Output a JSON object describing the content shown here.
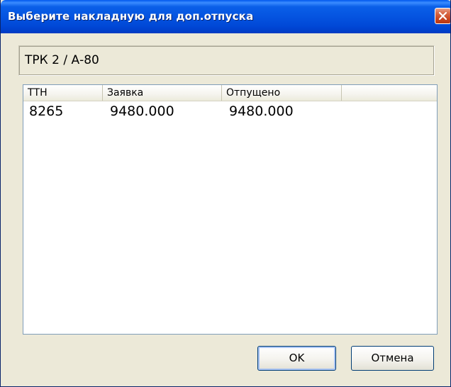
{
  "window": {
    "title": "Выберите накладную для доп.отпуска"
  },
  "header": {
    "text": "ТРК 2 / А-80"
  },
  "list": {
    "columns": [
      "ТТН",
      "Заявка",
      "Отпущено",
      ""
    ],
    "rows": [
      [
        "8265",
        "9480.000",
        "9480.000"
      ]
    ]
  },
  "buttons": {
    "ok": "OK",
    "cancel": "Отмена"
  },
  "icons": {
    "close": "close-icon"
  },
  "colors": {
    "titlebar": "#0554e0",
    "close_button": "#c9451f",
    "dialog_background": "#ece9d8"
  }
}
